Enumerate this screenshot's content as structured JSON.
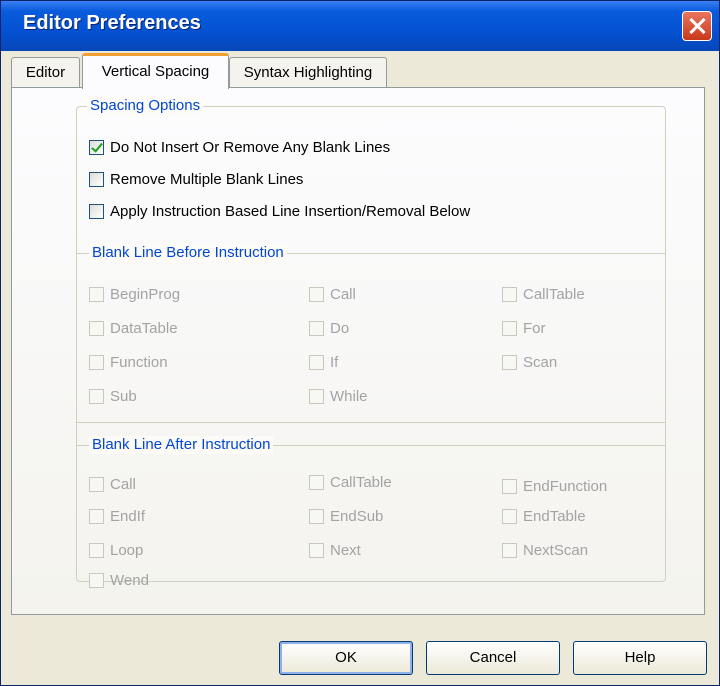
{
  "window": {
    "title": "Editor Preferences"
  },
  "tabs": [
    {
      "label": "Editor"
    },
    {
      "label": "Vertical Spacing"
    },
    {
      "label": "Syntax Highlighting"
    }
  ],
  "spacing_options": {
    "label": "Spacing Options",
    "items": [
      {
        "label": "Do Not Insert Or Remove Any Blank Lines",
        "checked": true
      },
      {
        "label": "Remove Multiple Blank Lines",
        "checked": false
      },
      {
        "label": "Apply Instruction Based Line Insertion/Removal Below",
        "checked": false
      }
    ]
  },
  "blank_before": {
    "label": "Blank Line Before Instruction",
    "items": [
      "BeginProg",
      "Call",
      "CallTable",
      "DataTable",
      "Do",
      "For",
      "Function",
      "If",
      "Scan",
      "Sub",
      "While"
    ]
  },
  "blank_after": {
    "label": "Blank Line After Instruction",
    "items": [
      "Call",
      "CallTable",
      "EndFunction",
      "EndIf",
      "EndSub",
      "EndTable",
      "Loop",
      "Next",
      "NextScan",
      "Wend"
    ]
  },
  "buttons": {
    "ok": "OK",
    "cancel": "Cancel",
    "help": "Help"
  }
}
